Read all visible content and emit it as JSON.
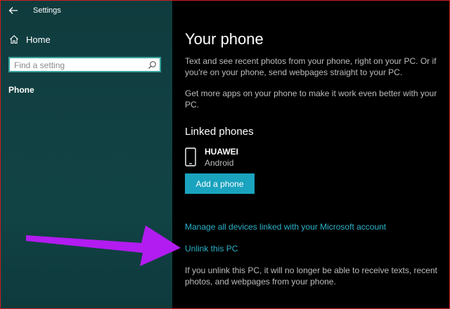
{
  "window": {
    "title": "Settings"
  },
  "sidebar": {
    "home_label": "Home",
    "search": {
      "placeholder": "Find a setting",
      "value": ""
    },
    "items": [
      {
        "label": "Phone",
        "selected": true
      }
    ]
  },
  "main": {
    "title": "Your phone",
    "description_1": "Text and see recent photos from your phone, right on your PC. Or if you're on your phone, send webpages straight to your PC.",
    "description_2": "Get more apps on your phone to make it work even better with your PC.",
    "linked_heading": "Linked phones",
    "device": {
      "name": "HUAWEI",
      "os": "Android"
    },
    "add_button_label": "Add a phone",
    "manage_link": "Manage all devices linked with your Microsoft account",
    "unlink_link": "Unlink this PC",
    "unlink_note": "If you unlink this PC, it will no longer be able to receive texts, recent photos, and webpages from your phone."
  },
  "icons": {
    "back": "back-arrow-icon",
    "home": "home-icon",
    "search": "search-icon",
    "phone": "phone-icon"
  },
  "colors": {
    "sidebar_bg": "#124143",
    "main_bg": "#000000",
    "accent": "#1aa3bf",
    "link": "#2bb2c9",
    "annotation_arrow": "#b21cf0",
    "frame_border": "#cc1f1f"
  }
}
